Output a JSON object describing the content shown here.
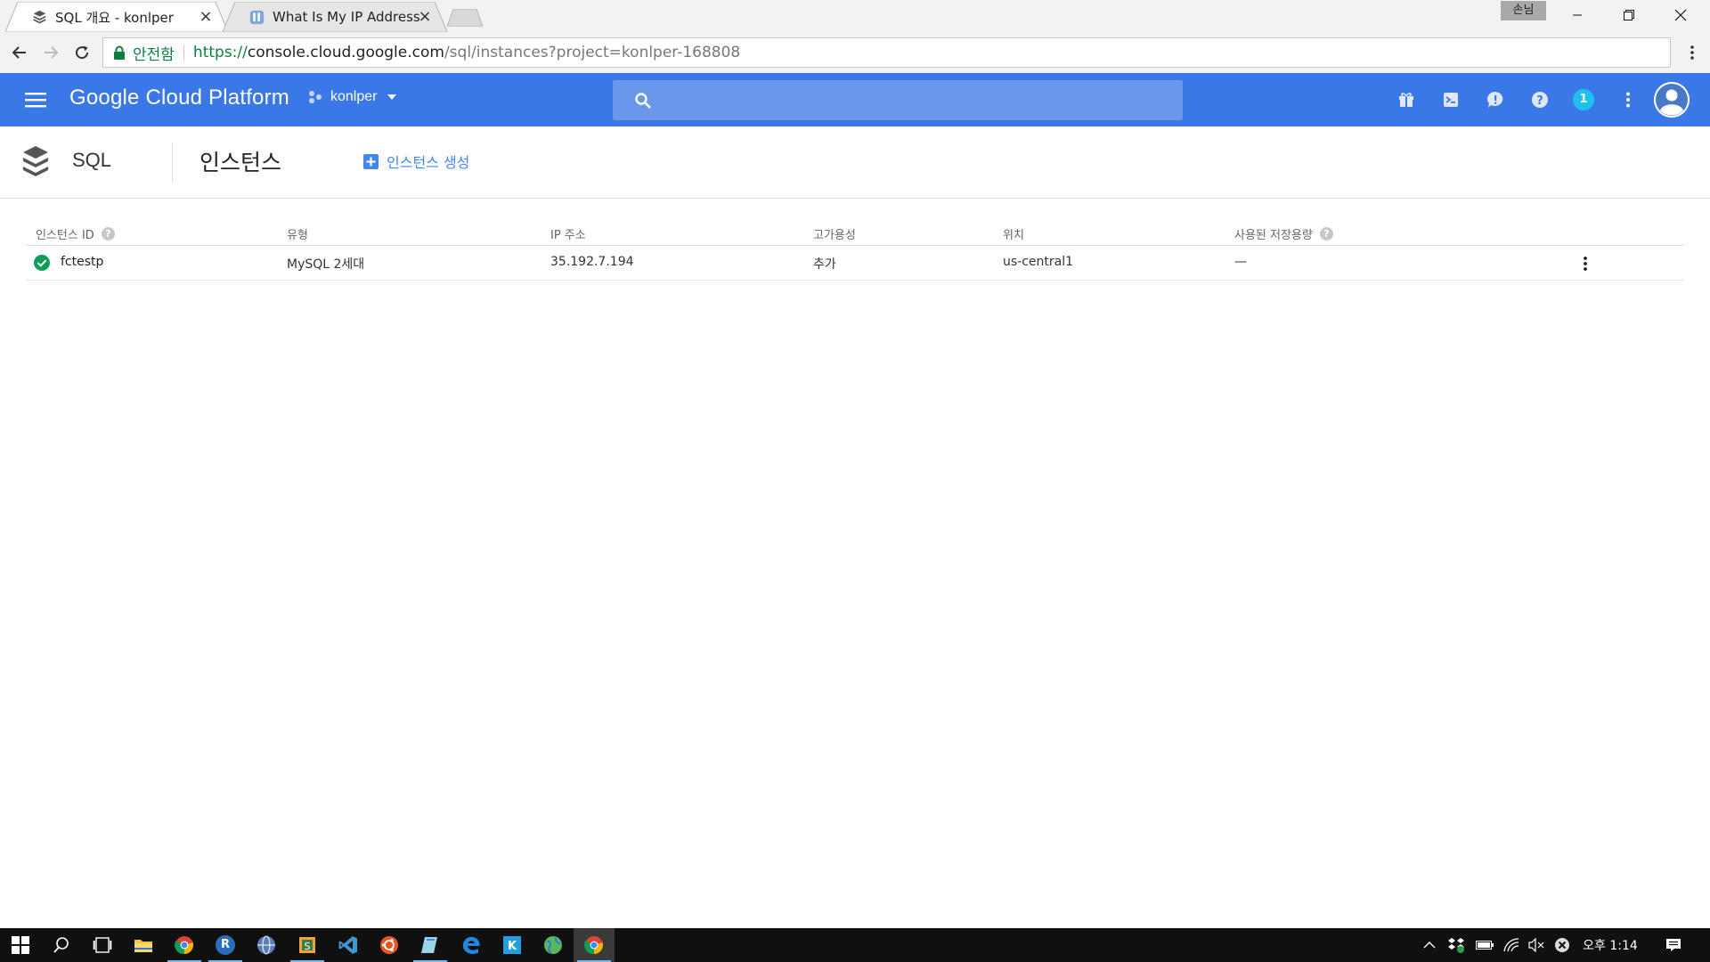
{
  "browser": {
    "tabs": [
      {
        "title": "SQL 개요 - konlper",
        "favicon": "gcp-sql-icon",
        "active": true
      },
      {
        "title": "What Is My IP Address",
        "favicon": "ip-site-icon",
        "active": false
      }
    ],
    "profile_label": "손님",
    "address_bar": {
      "secure_label": "안전함",
      "url_scheme": "https://",
      "url_host": "console.cloud.google.com",
      "url_path": "/sql/instances?project=konlper-168808"
    }
  },
  "gcp_header": {
    "logo_text": "Google Cloud Platform",
    "project_name": "konlper",
    "notification_count": "1",
    "colors": {
      "header_bg": "#3b78e7",
      "search_bg": "#6a97ec",
      "notification": "#1ec0ee"
    }
  },
  "subheader": {
    "product_name": "SQL",
    "page_title": "인스턴스",
    "create_button_label": "인스턴스 생성"
  },
  "table": {
    "columns": [
      {
        "label": "인스턴스 ID",
        "help": true
      },
      {
        "label": "유형",
        "help": false
      },
      {
        "label": "IP 주소",
        "help": false
      },
      {
        "label": "고가용성",
        "help": false
      },
      {
        "label": "위치",
        "help": false
      },
      {
        "label": "사용된 저장용량",
        "help": true
      }
    ],
    "rows": [
      {
        "status": "ok",
        "instance_id": "fctestp",
        "type": "MySQL 2세대",
        "ip": "35.192.7.194",
        "ha": "추가",
        "location": "us-central1",
        "storage": "—"
      }
    ]
  },
  "taskbar": {
    "clock": "오후 1:14",
    "apps": [
      "start-icon",
      "search-icon",
      "task-view-icon",
      "file-explorer-icon",
      "chrome-icon",
      "app-r-icon",
      "app-globe-icon",
      "app-s-icon",
      "vscode-icon",
      "ubuntu-icon",
      "app-book-icon",
      "edge-icon",
      "app-k-icon",
      "app-earth-icon",
      "chrome-active-icon"
    ]
  }
}
